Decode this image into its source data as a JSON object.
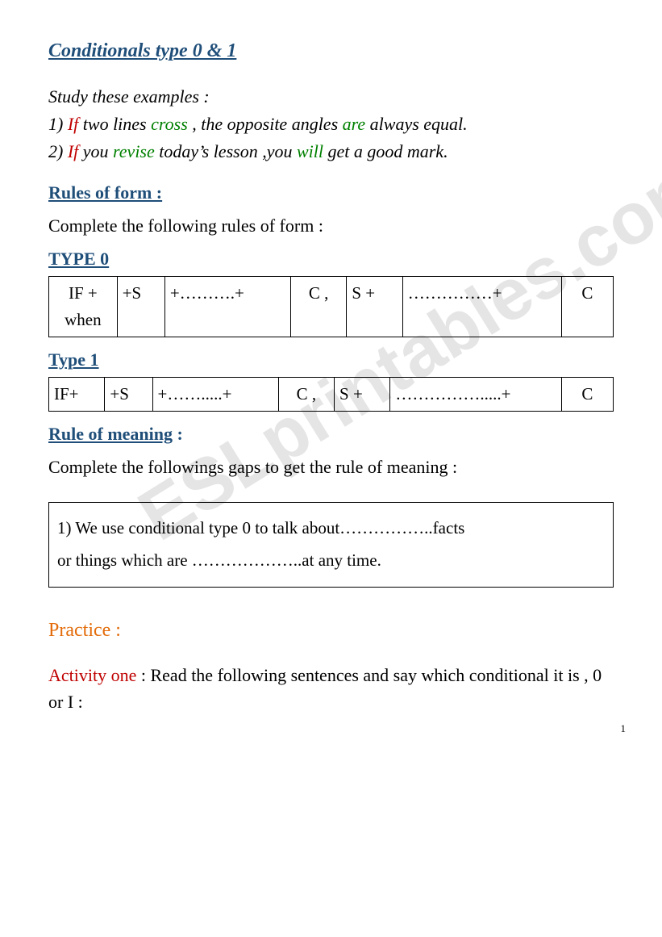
{
  "watermark": "ESLprintables.com",
  "title": "Conditionals  type 0 & 1",
  "examples": {
    "intro": "Study these examples :",
    "line1": {
      "num": "1) ",
      "if": "If ",
      "t1": " two lines  ",
      "v1": "cross",
      "t2": " , the  opposite   angles  ",
      "v2": "are",
      "t3": " always  equal."
    },
    "line2": {
      "num": "2)  ",
      "if": "If ",
      "t1": "you ",
      "v1": "revise ",
      "t2": " today’s lesson ,you  ",
      "v2": "will ",
      "t3": "get  a good mark."
    }
  },
  "rules_form_head": "Rules of form :",
  "rules_form_text": "Complete the following rules of form :",
  "type0_label": "TYPE 0",
  "type0_row": {
    "c1a": "IF +",
    "c1b": "when",
    "c2": "+S",
    "c3": "+……….+",
    "c4": "C ,",
    "c5": "S +",
    "c6": "……………+",
    "c7": "C"
  },
  "type1_label": "Type 1",
  "type1_row": {
    "c1": "IF+",
    "c2": "+S",
    "c3": "+…….....+",
    "c4": "C ,",
    "c5": "S +",
    "c6": "…………….....+",
    "c7": "C"
  },
  "meaning_head": "Rule of meaning",
  "meaning_colon": " :",
  "meaning_text": "Complete the followings gaps to get the rule of meaning :",
  "meaning_box_l1": "1) We use conditional type 0 to talk about……………..facts",
  "meaning_box_l2": "or things which are ………………..at any time.",
  "practice": "Practice :",
  "activity_label": "Activity one",
  "activity_text": " : Read the  following  sentences  and  say which conditional it is , 0 or I :",
  "page_number": "1"
}
